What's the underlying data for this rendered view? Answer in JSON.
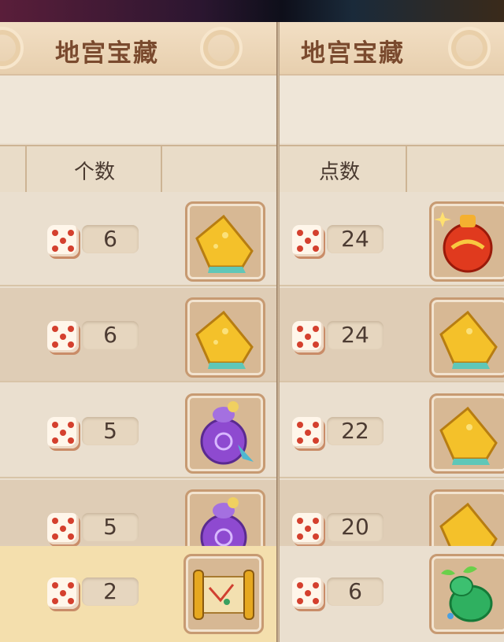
{
  "panels": [
    {
      "title": "地宫宝藏",
      "header": "个数",
      "rows": [
        {
          "value": "6",
          "item": "gold-ingot-icon"
        },
        {
          "value": "6",
          "item": "gold-ingot-icon"
        },
        {
          "value": "5",
          "item": "purple-pouch-icon"
        },
        {
          "value": "5",
          "item": "purple-pouch-icon"
        },
        {
          "value": "2",
          "item": "scroll-icon"
        }
      ]
    },
    {
      "title": "地宫宝藏",
      "header": "点数",
      "rows": [
        {
          "value": "24",
          "item": "red-lucky-bag-icon"
        },
        {
          "value": "24",
          "item": "gold-ingot-icon"
        },
        {
          "value": "22",
          "item": "gold-ingot-icon"
        },
        {
          "value": "20",
          "item": "gold-ingot-icon"
        },
        {
          "value": "6",
          "item": "green-gourd-icon"
        }
      ]
    }
  ],
  "colors": {
    "accent": "#7a4a2e",
    "die_pip": "#d4402e",
    "highlight_row": "#f4dfad"
  }
}
